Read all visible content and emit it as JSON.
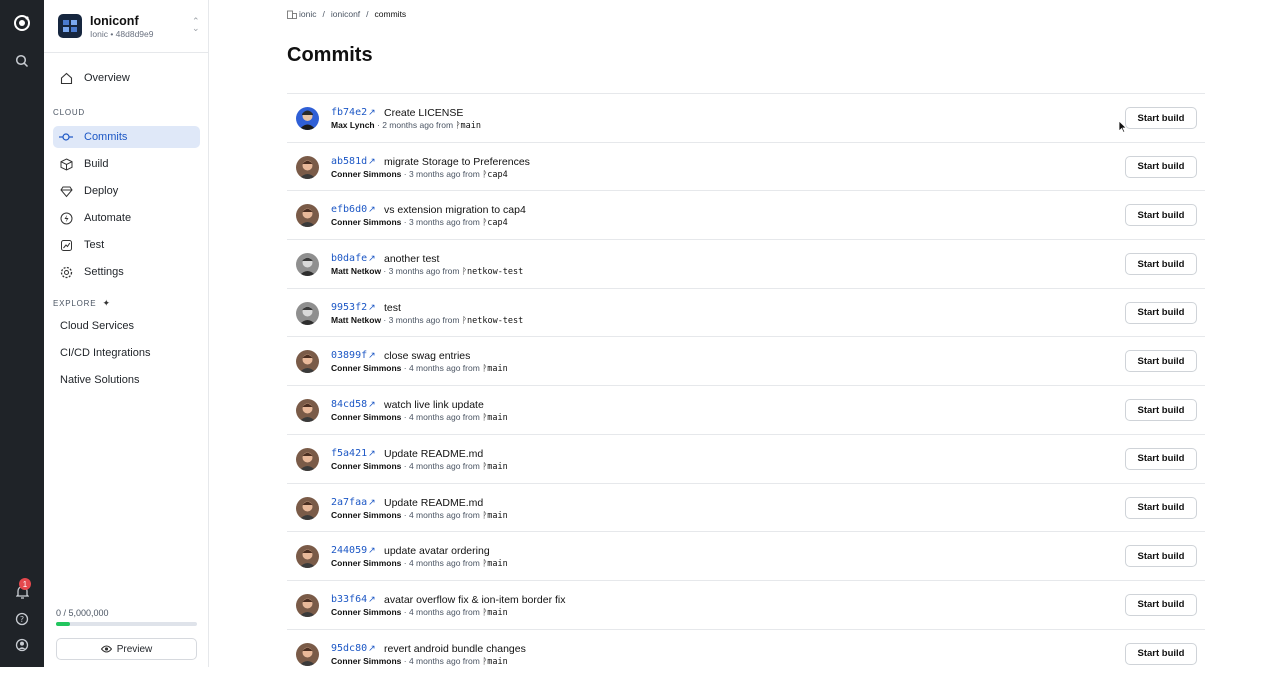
{
  "rail": {
    "notification_count": "1"
  },
  "app": {
    "title": "Ioniconf",
    "subtitle": "Ionic • 48d8d9e9"
  },
  "nav": {
    "overview": "Overview",
    "cloud_section": "CLOUD",
    "items": [
      {
        "label": "Commits",
        "icon": "commits-icon",
        "active": true
      },
      {
        "label": "Build",
        "icon": "cube-icon"
      },
      {
        "label": "Deploy",
        "icon": "diamond-icon"
      },
      {
        "label": "Automate",
        "icon": "bolt-icon"
      },
      {
        "label": "Test",
        "icon": "test-icon"
      },
      {
        "label": "Settings",
        "icon": "gear-icon"
      }
    ],
    "explore_section": "EXPLORE",
    "explore": [
      "Cloud Services",
      "CI/CD Integrations",
      "Native Solutions"
    ]
  },
  "usage": {
    "text": "0 / 5,000,000",
    "fraction": 0.1
  },
  "preview_label": "Preview",
  "breadcrumb": {
    "org": "ionic",
    "app": "ioniconf",
    "current": "commits"
  },
  "page_title": "Commits",
  "start_build_label": "Start build",
  "commits": [
    {
      "hash": "fb74e2",
      "message": "Create LICENSE",
      "author": "Max Lynch",
      "time": "2 months ago from",
      "branch": "main"
    },
    {
      "hash": "ab581d",
      "message": "migrate Storage to Preferences",
      "author": "Conner Simmons",
      "time": "3 months ago from",
      "branch": "cap4"
    },
    {
      "hash": "efb6d0",
      "message": "vs extension migration to cap4",
      "author": "Conner Simmons",
      "time": "3 months ago from",
      "branch": "cap4"
    },
    {
      "hash": "b0dafe",
      "message": "another test",
      "author": "Matt Netkow",
      "time": "3 months ago from",
      "branch": "netkow-test"
    },
    {
      "hash": "9953f2",
      "message": "test",
      "author": "Matt Netkow",
      "time": "3 months ago from",
      "branch": "netkow-test"
    },
    {
      "hash": "03899f",
      "message": "close swag entries",
      "author": "Conner Simmons",
      "time": "4 months ago from",
      "branch": "main"
    },
    {
      "hash": "84cd58",
      "message": "watch live link update",
      "author": "Conner Simmons",
      "time": "4 months ago from",
      "branch": "main"
    },
    {
      "hash": "f5a421",
      "message": "Update README.md",
      "author": "Conner Simmons",
      "time": "4 months ago from",
      "branch": "main"
    },
    {
      "hash": "2a7faa",
      "message": "Update README.md",
      "author": "Conner Simmons",
      "time": "4 months ago from",
      "branch": "main"
    },
    {
      "hash": "244059",
      "message": "update avatar ordering",
      "author": "Conner Simmons",
      "time": "4 months ago from",
      "branch": "main"
    },
    {
      "hash": "b33f64",
      "message": "avatar overflow fix & ion-item border fix",
      "author": "Conner Simmons",
      "time": "4 months ago from",
      "branch": "main"
    },
    {
      "hash": "95dc80",
      "message": "revert android bundle changes",
      "author": "Conner Simmons",
      "time": "4 months ago from",
      "branch": "main"
    }
  ],
  "colors": {
    "accent": "#1c57c5",
    "rail": "#1f2328",
    "active_bg": "#dfe8f8",
    "usage_fill": "#22c55e"
  }
}
